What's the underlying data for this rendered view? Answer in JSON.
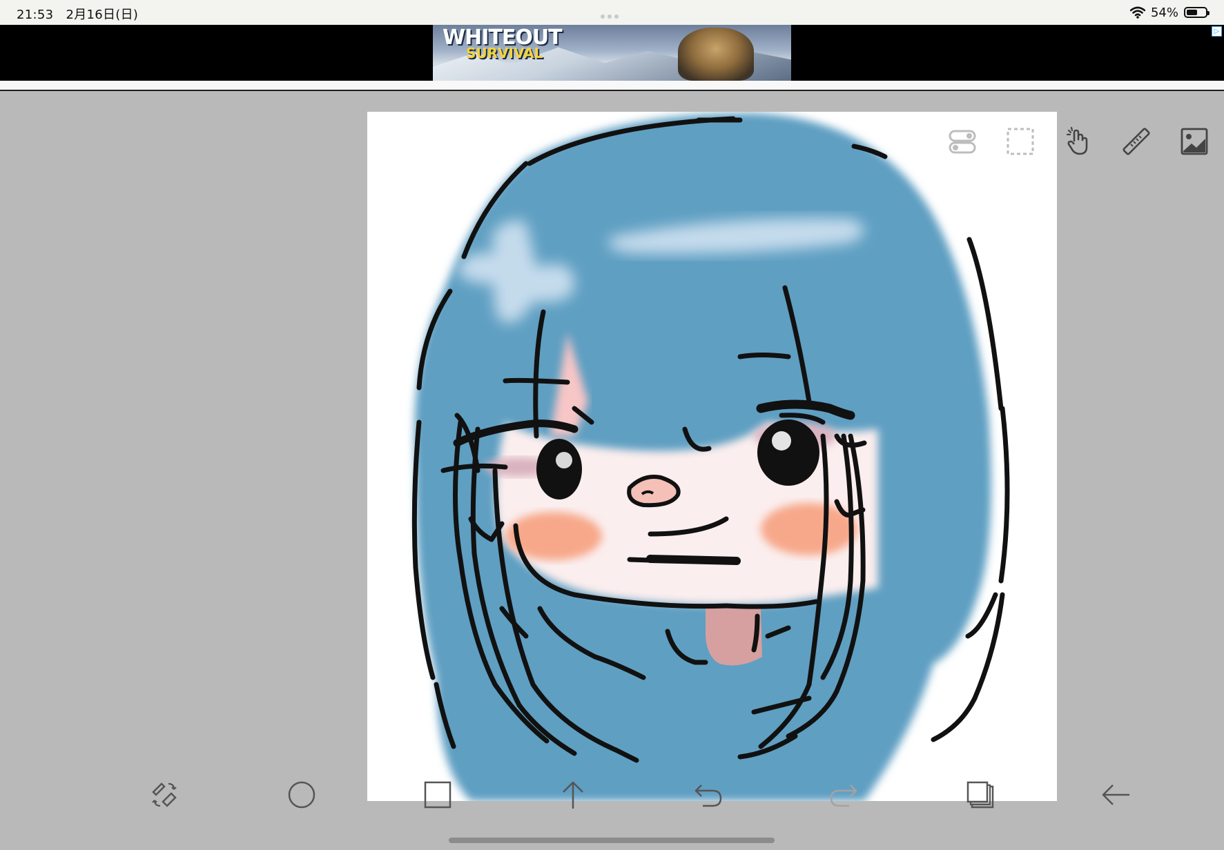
{
  "status_bar": {
    "time": "21:53",
    "date": "2月16日(日)",
    "battery_percent": "54%",
    "battery_level": 0.54,
    "wifi_icon": "wifi-icon"
  },
  "ad": {
    "title_line1": "WHITEOUT",
    "title_line2": "SURVIVAL",
    "adchoices_icon": "adchoices-icon"
  },
  "top_toolbar": [
    {
      "name": "layers-toggle-icon"
    },
    {
      "name": "selection-icon"
    },
    {
      "name": "hand-touch-icon"
    },
    {
      "name": "ruler-icon"
    },
    {
      "name": "image-import-icon"
    }
  ],
  "bottom_toolbar": [
    {
      "name": "pen-eraser-swap-icon"
    },
    {
      "name": "brush-circle-icon"
    },
    {
      "name": "color-square-icon"
    },
    {
      "name": "upload-arrow-icon"
    },
    {
      "name": "undo-icon"
    },
    {
      "name": "redo-icon"
    },
    {
      "name": "layers-icon"
    },
    {
      "name": "back-arrow-icon"
    }
  ],
  "colors": {
    "canvas_background": "#ffffff",
    "app_background": "#b9b9b9",
    "hair_blue": "#5f9fc2",
    "skin": "#fbeeee",
    "blush": "#f7a88a",
    "line_art": "#111111"
  }
}
